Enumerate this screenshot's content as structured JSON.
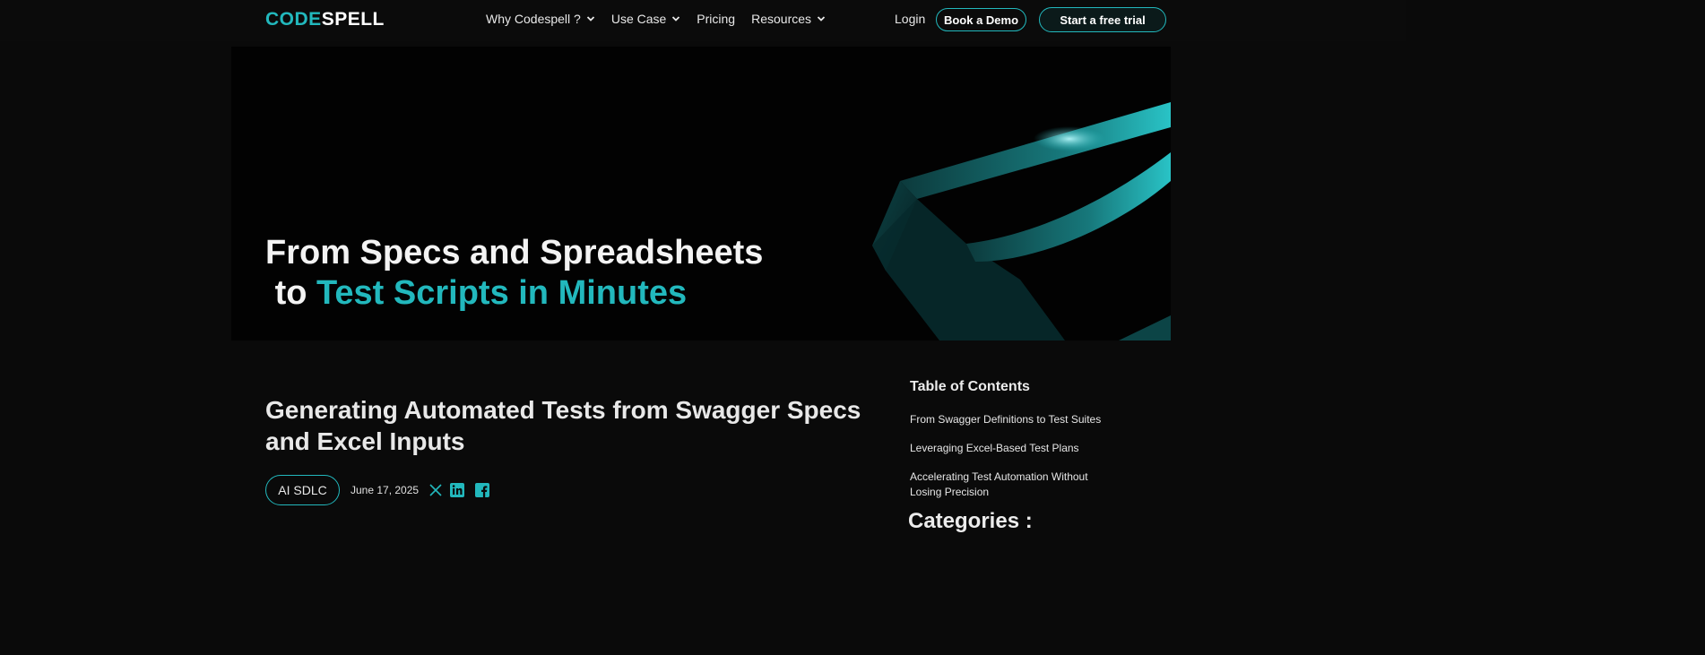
{
  "nav": {
    "logo_left": "CODE",
    "logo_right": "SPELL",
    "menu": [
      {
        "label": "Why Codespell ?",
        "has_dropdown": true
      },
      {
        "label": "Use Case",
        "has_dropdown": true
      },
      {
        "label": "Pricing",
        "has_dropdown": false
      },
      {
        "label": "Resources",
        "has_dropdown": true
      }
    ],
    "login": "Login",
    "demo": "Book a Demo",
    "trial": "Start a free trial"
  },
  "hero": {
    "line1": "From Specs and Spreadsheets",
    "line2_prefix": "to",
    "line2_accent": "Test Scripts in Minutes"
  },
  "article": {
    "title": "Generating Automated Tests from Swagger Specs and Excel Inputs",
    "tag": "AI SDLC",
    "date": "June 17, 2025",
    "share_icons": [
      "x-icon",
      "linkedin-icon",
      "facebook-icon"
    ]
  },
  "sidebar": {
    "toc_title": "Table of Contents",
    "toc": [
      "From Swagger Definitions to Test Suites",
      "Leveraging Excel-Based Test Plans",
      "Accelerating Test Automation Without Losing Precision"
    ],
    "categories_title": "Categories :"
  },
  "colors": {
    "accent": "#22b8bd",
    "background": "#0a0a0a",
    "text": "#e8e8e8"
  }
}
